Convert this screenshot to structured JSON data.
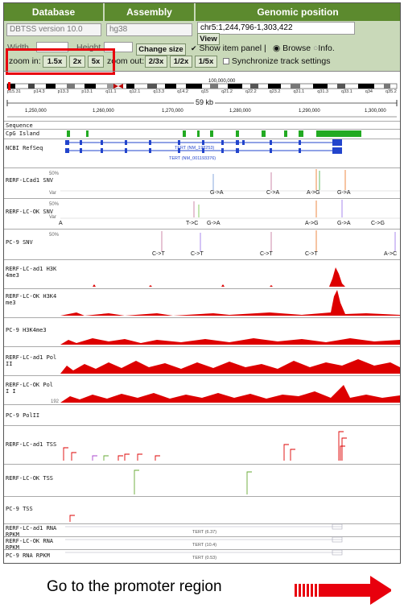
{
  "header": {
    "database_label": "Database",
    "assembly_label": "Assembly",
    "position_label": "Genomic position"
  },
  "controls": {
    "database_value": "DBTSS version 10.0",
    "assembly_value": "hg38",
    "position_value": "chr5:1,244,796-1,303,422",
    "view_button": "View",
    "width_label": "Width",
    "height_label": "Height",
    "change_size_button": "Change size",
    "show_item_panel": "Show item panel |",
    "browse_label": "Browse",
    "info_label": "Info.",
    "zoom_in_label": "zoom in:",
    "zoom_in_buttons": [
      "1.5x",
      "2x",
      "5x"
    ],
    "zoom_out_label": "zoom out:",
    "zoom_out_buttons": [
      "2/3x",
      "1/2x",
      "1/5x"
    ],
    "sync_label": "Synchronize track settings"
  },
  "ideogram": {
    "bands": [
      "p15.31",
      "p14.3",
      "p13.3",
      "p13.1",
      "q11.1",
      "q12.1",
      "q13.3",
      "q14.2",
      "q15",
      "q21.2",
      "q22.2",
      "q23.2",
      "q31.1",
      "q31.3",
      "q33.1",
      "q34",
      "q35.2"
    ],
    "scale_label": "100,000,000"
  },
  "ruler": {
    "span_label": "59 kb",
    "ticks": [
      "1,250,000",
      "1,260,000",
      "1,270,000",
      "1,280,000",
      "1,290,000",
      "1,300,000"
    ]
  },
  "tracks": {
    "sequence": "Sequence",
    "cpg": "CpG Island",
    "refseq": "NCBI RefSeq",
    "refseq_tx1": "TERT (NM_198253)",
    "refseq_tx2": "TERT (NM_001193376)",
    "snv1": "RERF-LCad1 SNV",
    "snv2": "RERF-LC-OK SNV",
    "snv3": "PC-9 SNV",
    "var": "Var",
    "pct": "50%",
    "snv1_alleles": [
      "G->A",
      "C->A",
      "A->G",
      "G->A"
    ],
    "snv2_alleles": [
      "A",
      "T->C",
      "G->A",
      "A->G",
      "G->A",
      "C->G"
    ],
    "snv3_alleles": [
      "C->T",
      "C->T",
      "C->T",
      "C->T",
      "A->C"
    ],
    "h3k_1": "RERF-LC-ad1 H3K 4me3",
    "h3k_2": "RERF-LC-OK H3K4 me3",
    "h3k_3": "PC-9 H3K4me3",
    "pol_1": "RERF-LC-ad1 Pol II",
    "pol_2": "RERF-LC-OK Pol I I",
    "pol_3": "PC-9 PolII",
    "tss_1": "RERF-LC-ad1 TSS",
    "tss_2": "RERF-LC-OK TSS",
    "tss_3": "PC-9 TSS",
    "rna_1": "RERF-LC-ad1 RNA RPKM",
    "rna_2": "RERF-LC-OK RNA RPKM",
    "rna_3": "PC-9 RNA RPKM",
    "rna_1_val": "TERT (6.37)",
    "rna_2_val": "TERT (10.4)",
    "rna_3_val": "TERT (0.53)",
    "scale_192": "192"
  },
  "caption": "Go to the promoter region",
  "colors": {
    "header": "#5c8a2e",
    "panel": "#c9d9b9",
    "signal": "#dd0000",
    "gene": "#2244cc",
    "cpg": "#22aa22",
    "highlight": "#e8000d"
  }
}
